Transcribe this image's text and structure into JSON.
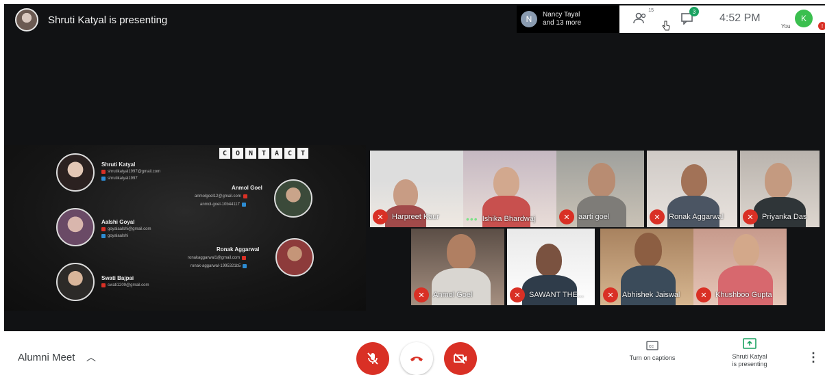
{
  "header": {
    "presenter_text": "Shruti Katyal is presenting",
    "people_chip": {
      "avatar_letter": "N",
      "line1": "Nancy Tayal",
      "line2": "and 13 more"
    },
    "participants_count": "15",
    "chat_badge": "3",
    "time": "4:52 PM",
    "you_avatar_letter": "K",
    "you_label": "You",
    "colors": {
      "accent_green": "#1aa260",
      "red": "#d93025"
    }
  },
  "slide": {
    "title_letters": [
      "C",
      "O",
      "N",
      "T",
      "A",
      "C",
      "T"
    ],
    "contacts": [
      {
        "name": "Shruti Katyal",
        "email": "shrutikatyal1997@gmail.com",
        "handle": "shrutikatyal1997"
      },
      {
        "name": "Aalshi Goyal",
        "email": "goyalaalshi@gmail.com",
        "handle": "goyalaalshi"
      },
      {
        "name": "Swati Bajpai",
        "email": "swati1209@gmail.com"
      },
      {
        "name": "Anmol Goel",
        "email": "anmolgoel12@gmail.com",
        "handle": "anmol-goel-10b44117"
      },
      {
        "name": "Ronak Aggarwal",
        "email": "ronakaggarwal1@gmail.com",
        "handle": "ronak-aggarwal-1995321b5"
      }
    ]
  },
  "tiles": [
    {
      "name": "Harpreet Kaur"
    },
    {
      "name": "Ishika Bhardwaj"
    },
    {
      "name": "aarti goel"
    },
    {
      "name": "Ronak Aggarwal"
    },
    {
      "name": "Priyanka Das"
    },
    {
      "name": "Anmol Goel"
    },
    {
      "name": "SAWANT THE..."
    },
    {
      "name": "Abhishek Jaiswal"
    },
    {
      "name": "Khushboo Gupta"
    }
  ],
  "bottom": {
    "meeting_name": "Alumni Meet",
    "captions_label": "Turn on captions",
    "present_label_1": "Shruti Katyal",
    "present_label_2": "is presenting"
  }
}
